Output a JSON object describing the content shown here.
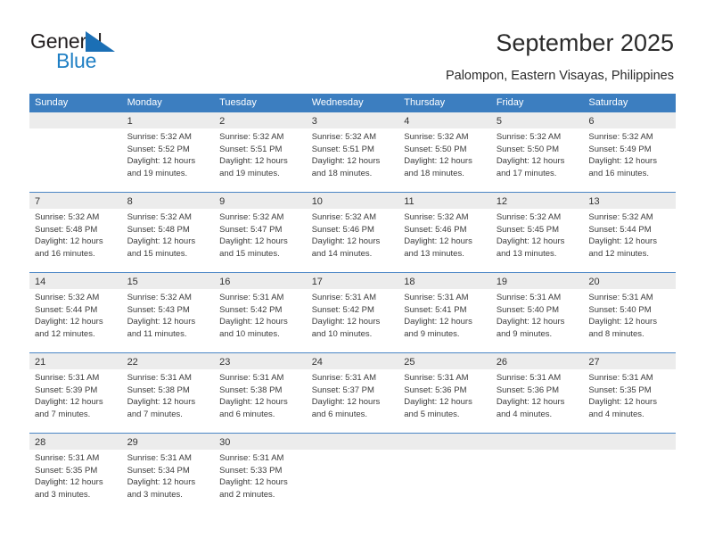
{
  "brand": {
    "name_part1": "General",
    "name_part2": "Blue",
    "triangle_color": "#1b6fb5",
    "text_color": "#231f20",
    "blue_color": "#1f7fc4"
  },
  "header": {
    "title": "September 2025",
    "subtitle": "Palompon, Eastern Visayas, Philippines"
  },
  "theme": {
    "header_blue": "#3c7ec0",
    "row_divider_blue": "#4a86c5",
    "daynum_band_gray": "#ececec",
    "text_color": "#333333"
  },
  "calendar": {
    "weekday_headers": [
      "Sunday",
      "Monday",
      "Tuesday",
      "Wednesday",
      "Thursday",
      "Friday",
      "Saturday"
    ],
    "weeks": [
      [
        {
          "day": "",
          "sunrise": "",
          "sunset": "",
          "daylight1": "",
          "daylight2": "",
          "empty": true
        },
        {
          "day": "1",
          "sunrise": "Sunrise: 5:32 AM",
          "sunset": "Sunset: 5:52 PM",
          "daylight1": "Daylight: 12 hours",
          "daylight2": "and 19 minutes."
        },
        {
          "day": "2",
          "sunrise": "Sunrise: 5:32 AM",
          "sunset": "Sunset: 5:51 PM",
          "daylight1": "Daylight: 12 hours",
          "daylight2": "and 19 minutes."
        },
        {
          "day": "3",
          "sunrise": "Sunrise: 5:32 AM",
          "sunset": "Sunset: 5:51 PM",
          "daylight1": "Daylight: 12 hours",
          "daylight2": "and 18 minutes."
        },
        {
          "day": "4",
          "sunrise": "Sunrise: 5:32 AM",
          "sunset": "Sunset: 5:50 PM",
          "daylight1": "Daylight: 12 hours",
          "daylight2": "and 18 minutes."
        },
        {
          "day": "5",
          "sunrise": "Sunrise: 5:32 AM",
          "sunset": "Sunset: 5:50 PM",
          "daylight1": "Daylight: 12 hours",
          "daylight2": "and 17 minutes."
        },
        {
          "day": "6",
          "sunrise": "Sunrise: 5:32 AM",
          "sunset": "Sunset: 5:49 PM",
          "daylight1": "Daylight: 12 hours",
          "daylight2": "and 16 minutes."
        }
      ],
      [
        {
          "day": "7",
          "sunrise": "Sunrise: 5:32 AM",
          "sunset": "Sunset: 5:48 PM",
          "daylight1": "Daylight: 12 hours",
          "daylight2": "and 16 minutes."
        },
        {
          "day": "8",
          "sunrise": "Sunrise: 5:32 AM",
          "sunset": "Sunset: 5:48 PM",
          "daylight1": "Daylight: 12 hours",
          "daylight2": "and 15 minutes."
        },
        {
          "day": "9",
          "sunrise": "Sunrise: 5:32 AM",
          "sunset": "Sunset: 5:47 PM",
          "daylight1": "Daylight: 12 hours",
          "daylight2": "and 15 minutes."
        },
        {
          "day": "10",
          "sunrise": "Sunrise: 5:32 AM",
          "sunset": "Sunset: 5:46 PM",
          "daylight1": "Daylight: 12 hours",
          "daylight2": "and 14 minutes."
        },
        {
          "day": "11",
          "sunrise": "Sunrise: 5:32 AM",
          "sunset": "Sunset: 5:46 PM",
          "daylight1": "Daylight: 12 hours",
          "daylight2": "and 13 minutes."
        },
        {
          "day": "12",
          "sunrise": "Sunrise: 5:32 AM",
          "sunset": "Sunset: 5:45 PM",
          "daylight1": "Daylight: 12 hours",
          "daylight2": "and 13 minutes."
        },
        {
          "day": "13",
          "sunrise": "Sunrise: 5:32 AM",
          "sunset": "Sunset: 5:44 PM",
          "daylight1": "Daylight: 12 hours",
          "daylight2": "and 12 minutes."
        }
      ],
      [
        {
          "day": "14",
          "sunrise": "Sunrise: 5:32 AM",
          "sunset": "Sunset: 5:44 PM",
          "daylight1": "Daylight: 12 hours",
          "daylight2": "and 12 minutes."
        },
        {
          "day": "15",
          "sunrise": "Sunrise: 5:32 AM",
          "sunset": "Sunset: 5:43 PM",
          "daylight1": "Daylight: 12 hours",
          "daylight2": "and 11 minutes."
        },
        {
          "day": "16",
          "sunrise": "Sunrise: 5:31 AM",
          "sunset": "Sunset: 5:42 PM",
          "daylight1": "Daylight: 12 hours",
          "daylight2": "and 10 minutes."
        },
        {
          "day": "17",
          "sunrise": "Sunrise: 5:31 AM",
          "sunset": "Sunset: 5:42 PM",
          "daylight1": "Daylight: 12 hours",
          "daylight2": "and 10 minutes."
        },
        {
          "day": "18",
          "sunrise": "Sunrise: 5:31 AM",
          "sunset": "Sunset: 5:41 PM",
          "daylight1": "Daylight: 12 hours",
          "daylight2": "and 9 minutes."
        },
        {
          "day": "19",
          "sunrise": "Sunrise: 5:31 AM",
          "sunset": "Sunset: 5:40 PM",
          "daylight1": "Daylight: 12 hours",
          "daylight2": "and 9 minutes."
        },
        {
          "day": "20",
          "sunrise": "Sunrise: 5:31 AM",
          "sunset": "Sunset: 5:40 PM",
          "daylight1": "Daylight: 12 hours",
          "daylight2": "and 8 minutes."
        }
      ],
      [
        {
          "day": "21",
          "sunrise": "Sunrise: 5:31 AM",
          "sunset": "Sunset: 5:39 PM",
          "daylight1": "Daylight: 12 hours",
          "daylight2": "and 7 minutes."
        },
        {
          "day": "22",
          "sunrise": "Sunrise: 5:31 AM",
          "sunset": "Sunset: 5:38 PM",
          "daylight1": "Daylight: 12 hours",
          "daylight2": "and 7 minutes."
        },
        {
          "day": "23",
          "sunrise": "Sunrise: 5:31 AM",
          "sunset": "Sunset: 5:38 PM",
          "daylight1": "Daylight: 12 hours",
          "daylight2": "and 6 minutes."
        },
        {
          "day": "24",
          "sunrise": "Sunrise: 5:31 AM",
          "sunset": "Sunset: 5:37 PM",
          "daylight1": "Daylight: 12 hours",
          "daylight2": "and 6 minutes."
        },
        {
          "day": "25",
          "sunrise": "Sunrise: 5:31 AM",
          "sunset": "Sunset: 5:36 PM",
          "daylight1": "Daylight: 12 hours",
          "daylight2": "and 5 minutes."
        },
        {
          "day": "26",
          "sunrise": "Sunrise: 5:31 AM",
          "sunset": "Sunset: 5:36 PM",
          "daylight1": "Daylight: 12 hours",
          "daylight2": "and 4 minutes."
        },
        {
          "day": "27",
          "sunrise": "Sunrise: 5:31 AM",
          "sunset": "Sunset: 5:35 PM",
          "daylight1": "Daylight: 12 hours",
          "daylight2": "and 4 minutes."
        }
      ],
      [
        {
          "day": "28",
          "sunrise": "Sunrise: 5:31 AM",
          "sunset": "Sunset: 5:35 PM",
          "daylight1": "Daylight: 12 hours",
          "daylight2": "and 3 minutes."
        },
        {
          "day": "29",
          "sunrise": "Sunrise: 5:31 AM",
          "sunset": "Sunset: 5:34 PM",
          "daylight1": "Daylight: 12 hours",
          "daylight2": "and 3 minutes."
        },
        {
          "day": "30",
          "sunrise": "Sunrise: 5:31 AM",
          "sunset": "Sunset: 5:33 PM",
          "daylight1": "Daylight: 12 hours",
          "daylight2": "and 2 minutes."
        },
        {
          "day": "",
          "sunrise": "",
          "sunset": "",
          "daylight1": "",
          "daylight2": "",
          "empty": true
        },
        {
          "day": "",
          "sunrise": "",
          "sunset": "",
          "daylight1": "",
          "daylight2": "",
          "empty": true
        },
        {
          "day": "",
          "sunrise": "",
          "sunset": "",
          "daylight1": "",
          "daylight2": "",
          "empty": true
        },
        {
          "day": "",
          "sunrise": "",
          "sunset": "",
          "daylight1": "",
          "daylight2": "",
          "empty": true
        }
      ]
    ]
  }
}
